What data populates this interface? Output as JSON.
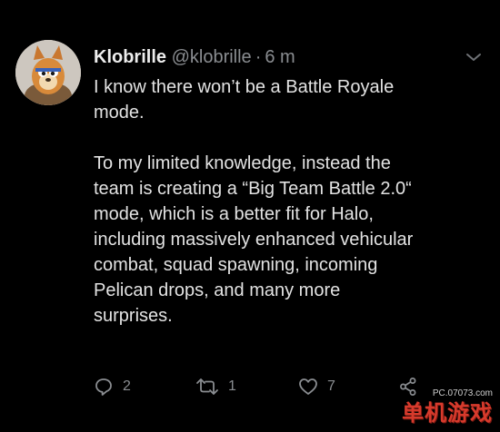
{
  "tweet": {
    "author_name": "Klobrille",
    "author_handle": "@klobrille",
    "separator": "·",
    "time": "6 m",
    "text": "I know there won’t be a Battle Royale\nmode.\n\nTo my limited knowledge, instead the\nteam is creating a “Big Team Battle 2.0“\nmode, which is a better fit for Halo,\nincluding massively enhanced vehicular\ncombat, squad spawning, incoming\nPelican drops, and many more\nsurprises.",
    "actions": {
      "reply_count": "2",
      "retweet_count": "1",
      "like_count": "7"
    },
    "icons": {
      "reply": "reply-icon",
      "retweet": "retweet-icon",
      "like": "heart-icon",
      "share": "share-icon",
      "more": "chevron-down-icon"
    }
  },
  "watermark": {
    "url": "PC.07073.com",
    "brand": "单机游戏"
  },
  "colors": {
    "background": "#000000",
    "text": "#e3e3e3",
    "muted": "#8a8d91",
    "brand_red": "#d63a2c"
  }
}
